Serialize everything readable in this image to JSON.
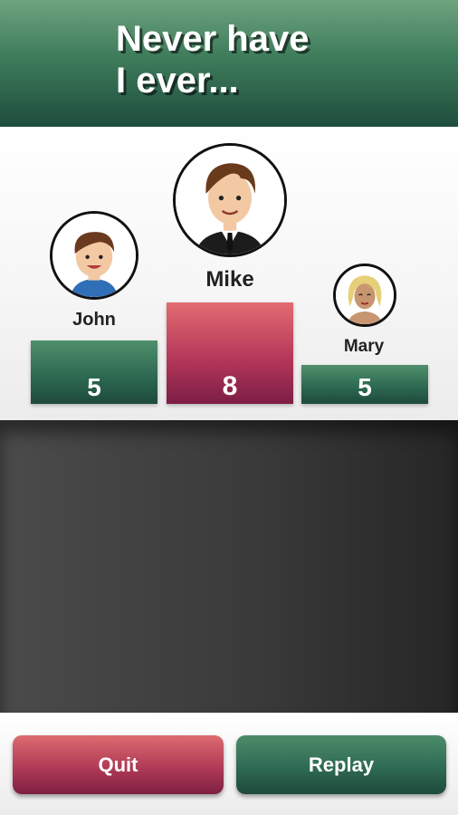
{
  "header": {
    "title_line1": "Never have",
    "title_line2": "I ever..."
  },
  "players": [
    {
      "name": "John",
      "score": "5",
      "rank": 2,
      "icon": "boy-avatar-icon"
    },
    {
      "name": "Mike",
      "score": "8",
      "rank": 1,
      "icon": "businessman-avatar-icon"
    },
    {
      "name": "Mary",
      "score": "5",
      "rank": 3,
      "icon": "blonde-girl-avatar-icon"
    }
  ],
  "buttons": {
    "quit_label": "Quit",
    "replay_label": "Replay"
  },
  "colors": {
    "green": "#2e6a52",
    "red": "#b5385a",
    "header": "#3e7c5b"
  }
}
